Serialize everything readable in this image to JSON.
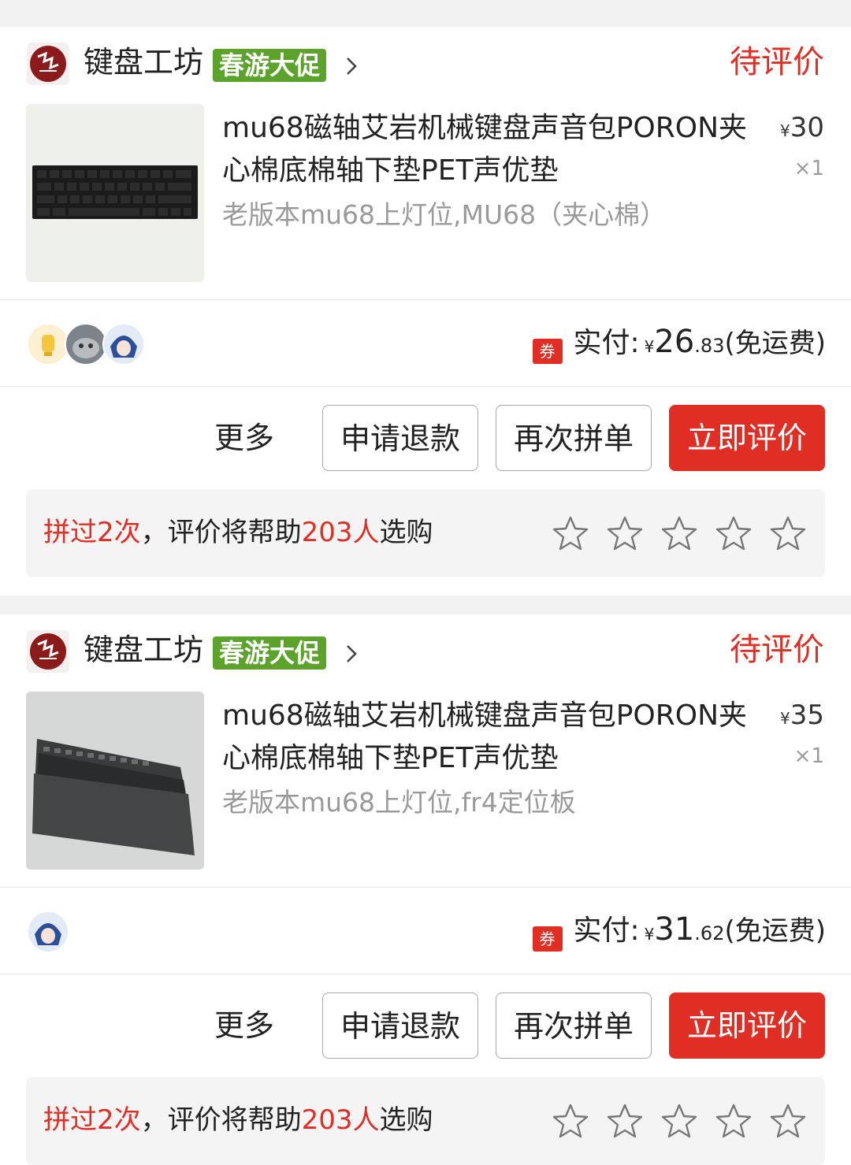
{
  "colors": {
    "accent": "#e02e24",
    "promo": "#5ba32b",
    "muted": "#9a9a9a",
    "box": "#f4f4f4"
  },
  "orders": [
    {
      "shop": {
        "name": "键盘工坊",
        "promo": "春游大促",
        "logo_icon": "shop-seal-logo"
      },
      "status": "待评价",
      "product": {
        "title": "mu68磁轴艾岩机械键盘声音包PORON夹心棉底棉轴下垫PET声优垫",
        "sku": "老版本mu68上灯位,MU68（夹心棉）",
        "price_symbol": "¥",
        "price": "30",
        "qty": "×1",
        "image_icon": "keyboard-foam-image"
      },
      "payment": {
        "coupon": "券",
        "label": "实付:",
        "symbol": "¥",
        "amount_int": "26",
        "amount_dec": ".83",
        "shipping": "(免运费)"
      },
      "buttons": {
        "more": "更多",
        "refund": "申请退款",
        "again": "再次拼单",
        "review": "立即评价"
      },
      "review_prompt": {
        "part1": "拼过2次",
        "part2": "，评价将帮助",
        "part3": "203人",
        "part4": "选购"
      },
      "stars": 0
    },
    {
      "shop": {
        "name": "键盘工坊",
        "promo": "春游大促",
        "logo_icon": "shop-seal-logo"
      },
      "status": "待评价",
      "product": {
        "title": "mu68磁轴艾岩机械键盘声音包PORON夹心棉底棉轴下垫PET声优垫",
        "sku": "老版本mu68上灯位,fr4定位板",
        "price_symbol": "¥",
        "price": "35",
        "qty": "×1",
        "image_icon": "keyboard-plate-image"
      },
      "payment": {
        "coupon": "券",
        "label": "实付:",
        "symbol": "¥",
        "amount_int": "31",
        "amount_dec": ".62",
        "shipping": "(免运费)"
      },
      "buttons": {
        "more": "更多",
        "refund": "申请退款",
        "again": "再次拼单",
        "review": "立即评价"
      },
      "review_prompt": {
        "part1": "拼过2次",
        "part2": "，评价将帮助",
        "part3": "203人",
        "part4": "选购"
      },
      "stars": 0
    }
  ]
}
